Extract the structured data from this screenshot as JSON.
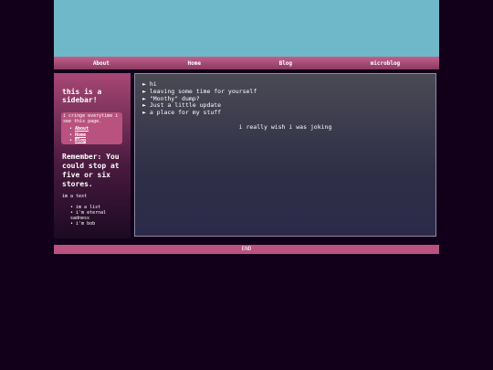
{
  "nav": [
    "About",
    "Home",
    "Blog",
    "microblog"
  ],
  "sidebar": {
    "title": "this is a sidebar!",
    "note": "i cringe everytime i see this page.",
    "links": [
      "About",
      "Home",
      "Blog"
    ],
    "remember": "Remember: You could stop at five or six stores.",
    "text": "im a text",
    "list": [
      "im a list",
      "i'm eternal sadness",
      "i'm bob"
    ]
  },
  "posts": [
    "hi",
    "leaving some time for yourself",
    "\"Monthy\" dump?",
    "Just a little update",
    "a place for my stuff"
  ],
  "quote": "i really wish i was joking",
  "footer": "END"
}
